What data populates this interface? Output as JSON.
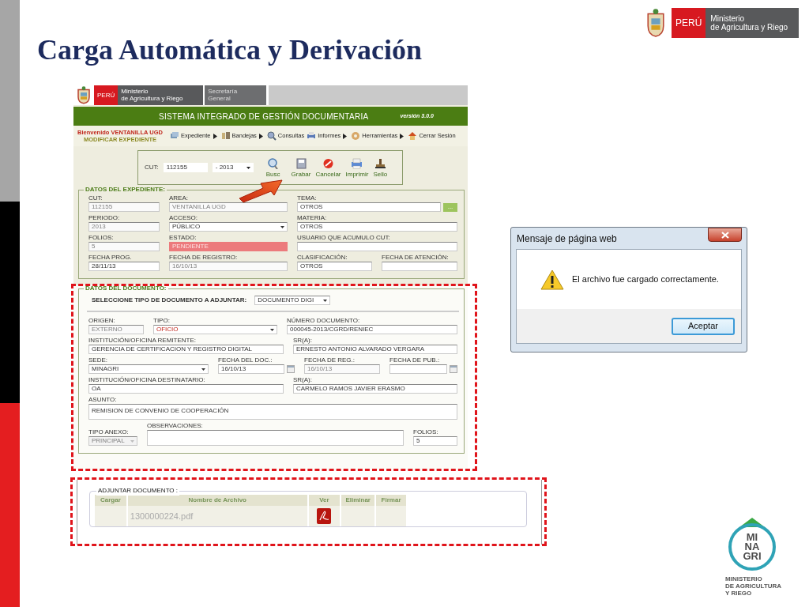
{
  "slide_title": "Carga Automática y Derivación",
  "header_logo": {
    "country": "PERÚ",
    "ministry": [
      "Ministerio",
      "de Agricultura y Riego"
    ]
  },
  "app": {
    "banner": {
      "country": "PERÚ",
      "ministry": [
        "Ministerio",
        "de Agricultura y Riego"
      ],
      "office": [
        "Secretaría",
        "General"
      ]
    },
    "system_title": "SISTEMA INTEGRADO DE GESTIÓN DOCUMENTARIA",
    "version": "versión 3.0.0",
    "welcome": "Bienvenido VENTANILLA UGD",
    "page_name": "MODIFICAR EXPEDIENTE",
    "menu": [
      {
        "label": "Expediente",
        "submenu": true
      },
      {
        "label": "Bandejas",
        "submenu": true
      },
      {
        "label": "Consultas",
        "submenu": false
      },
      {
        "label": "Informes",
        "submenu": true
      },
      {
        "label": "Herramientas",
        "submenu": true
      },
      {
        "label": "Cerrar Sesión",
        "submenu": false
      }
    ],
    "search": {
      "label": "CUT:",
      "value": "112155",
      "year": "- 2013"
    },
    "actions": [
      "Busc",
      "Grabar",
      "Cancelar",
      "Imprimir",
      "Sello"
    ],
    "expediente": {
      "legend": "DATOS DEL EXPEDIENTE:",
      "rows": [
        [
          {
            "label": "CUT:",
            "value": "112155",
            "kind": "readonly"
          },
          {
            "label": "AREA:",
            "value": "VENTANILLA UGD",
            "kind": "readonly"
          },
          {
            "label": "TEMA:",
            "value": "OTROS",
            "kind": "lookup",
            "button": "..."
          }
        ],
        [
          {
            "label": "PERIODO:",
            "value": "2013",
            "kind": "readonly"
          },
          {
            "label": "ACCESO:",
            "value": "PÚBLICO",
            "kind": "select"
          },
          {
            "label": "MATERIA:",
            "value": "OTROS",
            "kind": "text"
          }
        ],
        [
          {
            "label": "FOLIOS:",
            "value": "5",
            "kind": "readonly"
          },
          {
            "label": "ESTADO:",
            "value": "PENDIENTE",
            "kind": "alert"
          },
          {
            "label": "USUARIO QUE ACUMULO CUT:",
            "kind": "text"
          }
        ],
        [
          {
            "label": "FECHA PROG.",
            "value": "28/11/13",
            "kind": "text"
          },
          {
            "label": "FECHA DE REGISTRO:",
            "value": "16/10/13",
            "kind": "readonly"
          },
          {
            "label": "CLASIFICACIÓN:",
            "value": "OTROS",
            "kind": "text"
          },
          {
            "label": "FECHA DE ATENCIÓN:",
            "kind": "text"
          }
        ]
      ]
    },
    "documento": {
      "legend": "DATOS DEL DOCUMENTO:",
      "type_label": "SELECCIONE TIPO DE DOCUMENTO A ADJUNTAR:",
      "type_value": "DOCUMENTO DIGI",
      "lines": [
        {
          "fields": [
            {
              "label": "ORIGEN:",
              "value": "EXTERNO",
              "kind": "readonly"
            },
            {
              "label": "TIPO:",
              "value": "OFICIO",
              "kind": "select",
              "emphasis": true
            },
            {
              "label": "NÚMERO DOCUMENTO:",
              "value": "000045-2013/CGRD/RENIEC",
              "kind": "text"
            }
          ]
        },
        {
          "fields": [
            {
              "label": "INSTITUCIÓN/OFICINA REMITENTE:",
              "value": "GERENCIA DE CERTIFICACION Y REGISTRO DIGITAL",
              "kind": "text"
            },
            {
              "label": "SR(A):",
              "value": "ERNESTO ANTONIO ALVARADO VERGARA",
              "kind": "text"
            }
          ]
        },
        {
          "fields": [
            {
              "label": "SEDE:",
              "value": "MINAGRI",
              "kind": "select"
            },
            {
              "label": "FECHA DEL DOC.:",
              "value": "16/10/13",
              "kind": "date"
            },
            {
              "label": "FECHA DE REG.:",
              "value": "16/10/13",
              "kind": "readonly"
            },
            {
              "label": "FECHA DE PUB.:",
              "kind": "date"
            }
          ]
        },
        {
          "fields": [
            {
              "label": "INSTITUCIÓN/OFICINA DESTINATARIO:",
              "value": "OA",
              "kind": "text"
            },
            {
              "label": "SR(A):",
              "value": "CARMELO RAMOS JAVIER ERASMO",
              "kind": "text"
            }
          ]
        },
        {
          "fields": [
            {
              "label": "ASUNTO:",
              "value": "REMISION DE CONVENIO DE COOPERACIÓN",
              "kind": "textarea"
            }
          ]
        },
        {
          "fields": [
            {
              "label": "TIPO ANEXO:",
              "value": "PRINCIPAL",
              "kind": "disabled_select"
            },
            {
              "label": "OBSERVACIONES:",
              "kind": "textarea"
            },
            {
              "label": "FOLIOS:",
              "value": "5",
              "kind": "text"
            }
          ]
        }
      ]
    }
  },
  "attachments": {
    "legend": "ADJUNTAR DOCUMENTO :",
    "columns": [
      "Cargar",
      "Nombre de Archivo",
      "Ver",
      "Eliminar",
      "Firmar"
    ],
    "rows": [
      {
        "file": "1300000224.pdf"
      }
    ]
  },
  "dialog": {
    "title": "Mensaje de página web",
    "message": "El archivo fue cargado correctamente.",
    "button": "Aceptar"
  },
  "minagri_logo": {
    "letters": [
      "MI",
      "NA",
      "GRI"
    ],
    "caption": [
      "MINISTERIO",
      "DE AGRICULTURA",
      "Y RIEGO"
    ]
  }
}
